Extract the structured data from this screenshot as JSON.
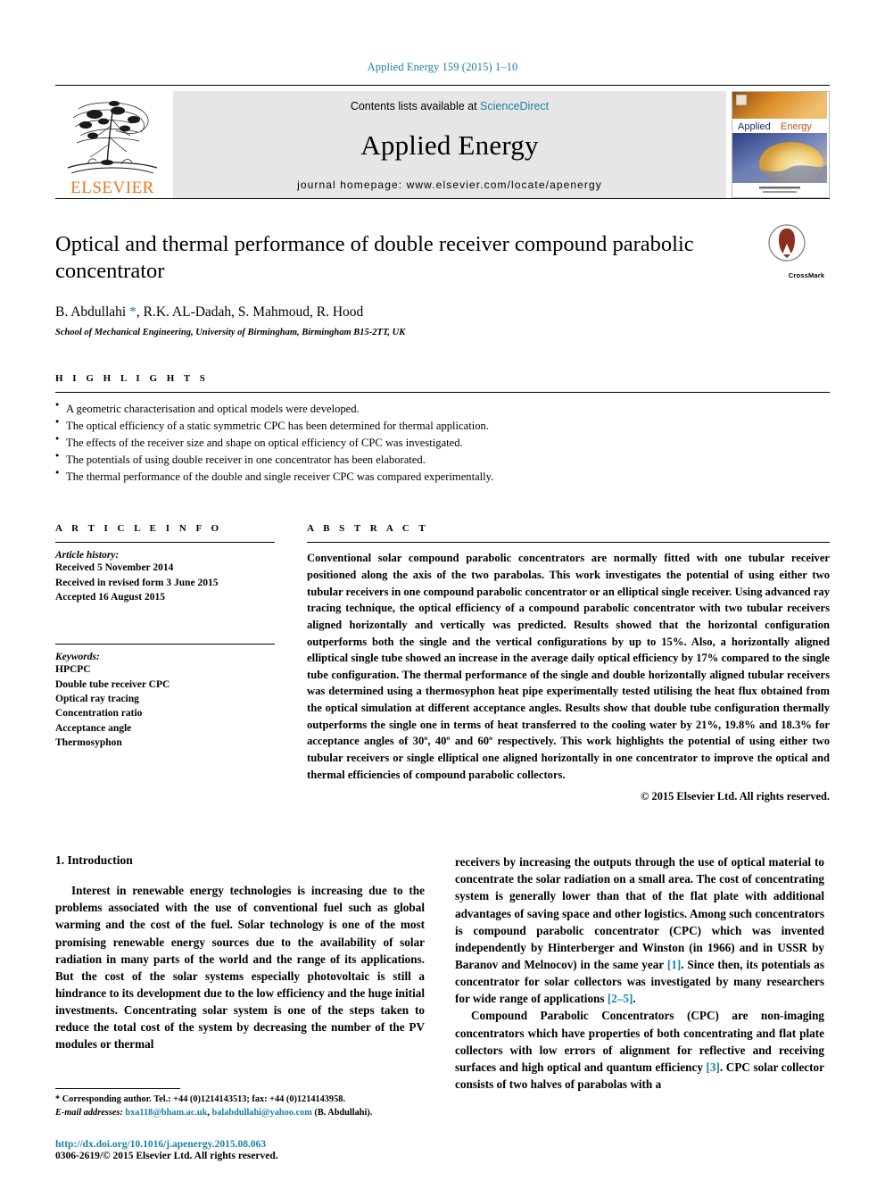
{
  "running_head": "Applied Energy 159 (2015) 1–10",
  "masthead": {
    "publisher_name": "ELSEVIER",
    "contents_prefix": "Contents lists available at ",
    "contents_link": "ScienceDirect",
    "journal_title": "Applied Energy",
    "homepage": "journal homepage: www.elsevier.com/locate/apenergy",
    "cover_title_left": "Applied",
    "cover_title_right": "Energy"
  },
  "article": {
    "title": "Optical and thermal performance of double receiver compound parabolic concentrator",
    "crossmark_label": "CrossMark",
    "authors": "B. Abdullahi ",
    "corresponding_marker": "*",
    "authors_rest": ", R.K. AL-Dadah, S. Mahmoud, R. Hood",
    "affiliation": "School of Mechanical Engineering, University of Birmingham, Birmingham B15-2TT, UK"
  },
  "highlights": {
    "heading": "H I G H L I G H T S",
    "items": [
      "A geometric characterisation and optical models were developed.",
      "The optical efficiency of a static symmetric CPC has been determined for thermal application.",
      "The effects of the receiver size and shape on optical efficiency of CPC was investigated.",
      "The potentials of using double receiver in one concentrator has been elaborated.",
      "The thermal performance of the double and single receiver CPC was compared experimentally."
    ]
  },
  "article_info": {
    "heading": "A R T I C L E    I N F O",
    "history_label": "Article history:",
    "history": [
      "Received 5 November 2014",
      "Received in revised form 3 June 2015",
      "Accepted 16 August 2015"
    ],
    "keywords_label": "Keywords:",
    "keywords": [
      "HPCPC",
      "Double tube receiver CPC",
      "Optical ray tracing",
      "Concentration ratio",
      "Acceptance angle",
      "Thermosyphon"
    ]
  },
  "abstract": {
    "heading": "A B S T R A C T",
    "text": "Conventional solar compound parabolic concentrators are normally fitted with one tubular receiver positioned along the axis of the two parabolas. This work investigates the potential of using either two tubular receivers in one compound parabolic concentrator or an elliptical single receiver. Using advanced ray tracing technique, the optical efficiency of a compound parabolic concentrator with two tubular receivers aligned horizontally and vertically was predicted. Results showed that the horizontal configuration outperforms both the single and the vertical configurations by up to 15%. Also, a horizontally aligned elliptical single tube showed an increase in the average daily optical efficiency by 17% compared to the single tube configuration. The thermal performance of the single and double horizontally aligned tubular receivers was determined using a thermosyphon heat pipe experimentally tested utilising the heat flux obtained from the optical simulation at different acceptance angles. Results show that double tube configuration thermally outperforms the single one in terms of heat transferred to the cooling water by 21%, 19.8% and 18.3% for acceptance angles of 30º, 40º and 60º respectively. This work highlights the potential of using either two tubular receivers or single elliptical one aligned horizontally in one concentrator to improve the optical and thermal efficiencies of compound parabolic collectors.",
    "copyright": "© 2015 Elsevier Ltd. All rights reserved."
  },
  "introduction": {
    "section_title": "1. Introduction",
    "left_para": "Interest in renewable energy technologies is increasing due to the problems associated with the use of conventional fuel such as global warming and the cost of the fuel. Solar technology is one of the most promising renewable energy sources due to the availability of solar radiation in many parts of the world and the range of its applications. But the cost of the solar systems especially photovoltaic is still a hindrance to its development due to the low efficiency and the huge initial investments. Concentrating solar system is one of the steps taken to reduce the total cost of the system by decreasing the number of the PV modules or thermal",
    "right_para_1a": "receivers by increasing the outputs through the use of optical material to concentrate the solar radiation on a small area. The cost of concentrating system is generally lower than that of the flat plate with additional advantages of saving space and other logistics. Among such concentrators is compound parabolic concentrator (CPC) which was invented independently by Hinterberger and Winston (in 1966) and in USSR by Baranov and Melnocov) in the same year ",
    "right_ref_1": "[1]",
    "right_para_1b": ". Since then, its potentials as concentrator for solar collectors was investigated by many researchers for wide range of applications ",
    "right_ref_2": "[2–5]",
    "right_para_1c": ".",
    "right_para_2a": "Compound Parabolic Concentrators (CPC) are non-imaging concentrators which have properties of both concentrating and flat plate collectors with low errors of alignment for reflective and receiving surfaces and high optical and quantum efficiency ",
    "right_ref_3": "[3]",
    "right_para_2b": ". CPC solar collector consists of two halves of parabolas with a"
  },
  "footer": {
    "corresponding_marker": "*",
    "corresponding_text": "Corresponding author. Tel.: +44 (0)1214143513; fax: +44 (0)1214143958.",
    "email_label": "E-mail addresses:",
    "email_1": "bxa118@bham.ac.uk",
    "email_sep": ", ",
    "email_2": "balabdullahi@yahoo.com",
    "email_suffix": " (B. Abdullahi).",
    "doi": "http://dx.doi.org/10.1016/j.apenergy.2015.08.063",
    "issn": "0306-2619/© 2015 Elsevier Ltd. All rights reserved."
  },
  "colors": {
    "link": "#1a7fa8",
    "elsevier_orange": "#E87722",
    "banner_grey": "#e6e6e6"
  }
}
